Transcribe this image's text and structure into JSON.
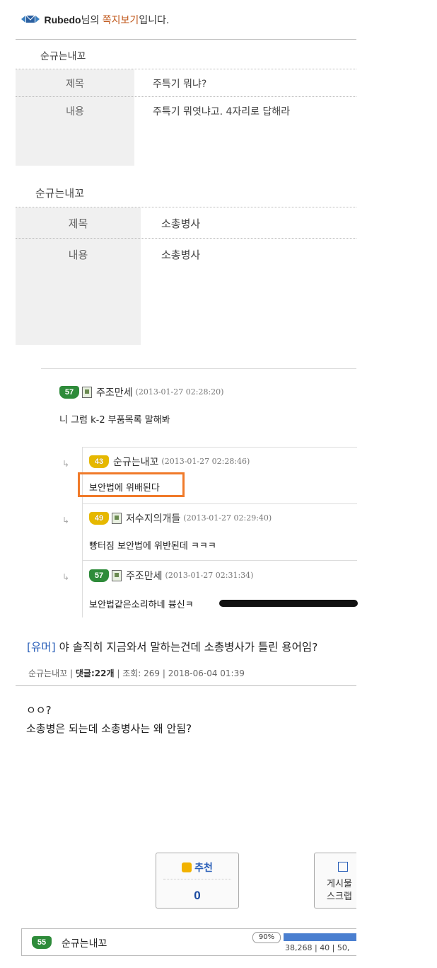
{
  "header": {
    "username": "Rubedo",
    "suffix_1": "님의 ",
    "highlight": "쪽지보기",
    "suffix_2": "입니다."
  },
  "messages": [
    {
      "sender": "순규는내꼬",
      "title_label": "제목",
      "title": "주특기 뭐냐?",
      "content_label": "내용",
      "content": "주특기 뭐엿냐고. 4자리로 답해라"
    },
    {
      "sender": "순규는내꼬",
      "title_label": "제목",
      "title": "소총병사",
      "content_label": "내용",
      "content": "소총병사"
    }
  ],
  "comments": [
    {
      "level": "57",
      "name": "주조만세",
      "date": "(2013-01-27 02:28:20)",
      "text": "니 그럼 k-2 부품목록 말해봐"
    },
    {
      "level": "43",
      "name": "순규는내꼬",
      "date": "(2013-01-27 02:28:46)",
      "text": "보안법에 위배된다"
    },
    {
      "level": "49",
      "name": "저수지의개들",
      "date": "(2013-01-27 02:29:40)",
      "text": "빵터짐 보안법에 위반된데 ㅋㅋㅋ"
    },
    {
      "level": "57",
      "name": "주조만세",
      "date": "(2013-01-27 02:31:34)",
      "text": "보안법같은소리하네 븅신ㅋ"
    }
  ],
  "reply_arrow": "↳",
  "post": {
    "category": "[유머]",
    "title": "야 솔직히 지금와서 말하는건데 소총병사가 틀린 용어임?",
    "author": "순규는내꼬",
    "comments_label": "댓글:",
    "comments_count": "22",
    "comments_unit": "개",
    "views_label": "조회:",
    "views": "269",
    "datetime": "2018-06-04 01:39",
    "body_line_1": "ㅇㅇ?",
    "body_line_2": "소총병은 되는데 소총병사는 왜 안됨?"
  },
  "buttons": {
    "recommend_label": "추천",
    "recommend_count": "0",
    "scrap_line_1": "게시물",
    "scrap_line_2": "스크랩"
  },
  "footer": {
    "level": "55",
    "name": "순규는내꼬",
    "progress_text": "90%",
    "progress": 0.9,
    "stats": "38,268 | 40 | 50,"
  },
  "colors": {
    "highlight": "#c0571a",
    "category": "#2a5fb8",
    "box_highlight": "#f07a2a",
    "level_green": "#2e8b3a",
    "level_yellow": "#e6b800"
  }
}
